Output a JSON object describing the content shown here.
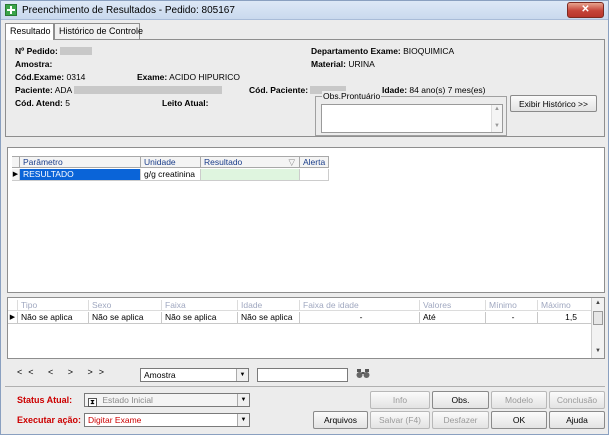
{
  "window": {
    "title": "Preenchimento de Resultados - Pedido: 805167",
    "close_label": "✕"
  },
  "tabs": [
    {
      "label": "Resultado",
      "active": true
    },
    {
      "label": "Histórico de Controle",
      "active": false
    }
  ],
  "info": {
    "pedido_label": "Nº Pedido:",
    "amostra_label": "Amostra:",
    "cod_exame_label": "Cód.Exame:",
    "cod_exame_value": "0314",
    "exame_label": "Exame:",
    "exame_value": "ACIDO HIPURICO",
    "paciente_label": "Paciente:",
    "paciente_value": "ADA",
    "cod_atend_label": "Cód. Atend:",
    "cod_atend_value": "5",
    "leito_label": "Leito Atual:",
    "departamento_label": "Departamento Exame:",
    "departamento_value": "BIOQUIMICA",
    "material_label": "Material:",
    "material_value": "URINA",
    "cod_paciente_label": "Cód. Paciente:",
    "idade_label": "Idade:",
    "idade_value": "84 ano(s) 7 mes(es)",
    "obs_legend": "Obs.Prontuário",
    "historico_button": "Exibir Histórico >>"
  },
  "grid1": {
    "columns": [
      "Parâmetro",
      "Unidade",
      "Resultado",
      "Alerta"
    ],
    "rows": [
      {
        "parametro": "RESULTADO",
        "unidade": "g/g creatinina",
        "resultado": "",
        "alerta": ""
      }
    ]
  },
  "grid2": {
    "columns": [
      "Tipo",
      "Sexo",
      "Faixa",
      "Idade",
      "Faixa de idade",
      "Valores",
      "Mínimo",
      "Máximo"
    ],
    "rows": [
      {
        "tipo": "Não se aplica",
        "sexo": "Não se aplica",
        "faixa": "Não se aplica",
        "idade": "Não se aplica",
        "faixa_idade": "-",
        "valores": "Até",
        "minimo": "-",
        "maximo": "1,5"
      }
    ]
  },
  "nav": {
    "controls": "<<   <   >   >>",
    "amostra_select": "Amostra",
    "search_value": ""
  },
  "status": {
    "label": "Status Atual:",
    "value": "Estado Inicial"
  },
  "acao": {
    "label": "Executar ação:",
    "value": "Digitar Exame"
  },
  "buttons": {
    "info": "Info",
    "obs": "Obs.",
    "modelo": "Modelo",
    "conclusao": "Conclusão",
    "arquivos": "Arquivos",
    "salvar": "Salvar (F4)",
    "desfazer": "Desfazer",
    "ok": "OK",
    "ajuda": "Ajuda"
  },
  "colors": {
    "title_bg": "#c9d9ee",
    "selection": "#0a64d8",
    "result_cell": "#dff5df",
    "label_red": "#cc0000"
  }
}
